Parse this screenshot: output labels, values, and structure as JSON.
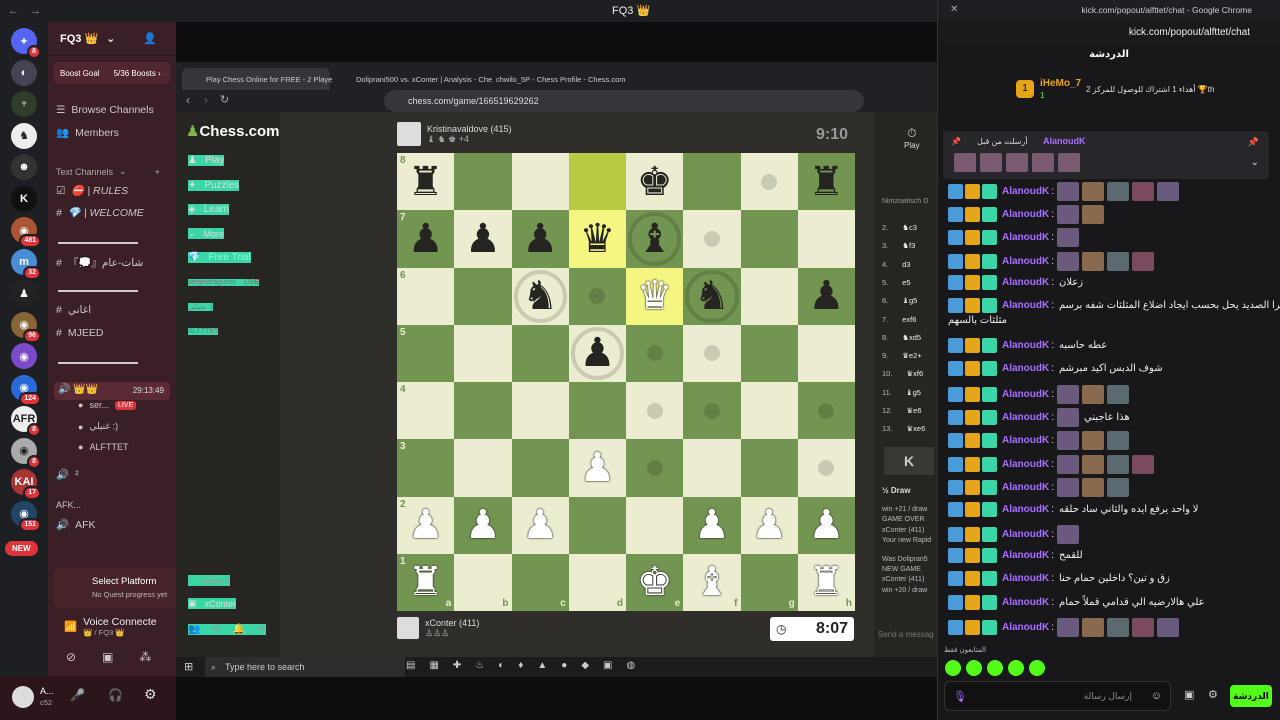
{
  "topbar": {
    "back": "←",
    "fwd": "→",
    "title": "FQ3 👑"
  },
  "rail": {
    "servers": [
      {
        "name": "discord",
        "badge": "8",
        "color": "#5865f2",
        "icon": "✦"
      },
      {
        "name": "s2",
        "badge": "",
        "color": "#445",
        "icon": "◐"
      },
      {
        "name": "s3",
        "badge": "",
        "color": "#2f3d2a",
        "icon": "♆"
      },
      {
        "name": "s4",
        "badge": "",
        "color": "#eee",
        "icon": "♞"
      },
      {
        "name": "s5",
        "badge": "",
        "color": "#333",
        "icon": "☻"
      },
      {
        "name": "kick",
        "badge": "",
        "color": "#111",
        "icon": "K"
      },
      {
        "name": "s7",
        "badge": "481",
        "color": "#a53",
        "icon": "◉"
      },
      {
        "name": "s8",
        "badge": "32",
        "color": "#4a8cd8",
        "icon": "m"
      },
      {
        "name": "s9",
        "badge": "",
        "color": "#222",
        "icon": "♟"
      },
      {
        "name": "s10",
        "badge": "96",
        "color": "#863",
        "icon": "◉"
      },
      {
        "name": "s11",
        "badge": "",
        "color": "#7a4ac8",
        "icon": "◉"
      },
      {
        "name": "s12",
        "badge": "124",
        "color": "#2a6ad8",
        "icon": "◉"
      },
      {
        "name": "s13",
        "badge": "8",
        "color": "#eee",
        "icon": "AFR"
      },
      {
        "name": "s14",
        "badge": "8",
        "color": "#aaa",
        "icon": "◉"
      },
      {
        "name": "s15",
        "badge": "17",
        "color": "#a33",
        "icon": "KAI"
      },
      {
        "name": "s16",
        "badge": "151",
        "color": "#246",
        "icon": "◉"
      }
    ],
    "new_label": "NEW"
  },
  "discord": {
    "server_name": "FQ3 👑",
    "boost_goal": "Boost Goal",
    "boost_count": "5/36 Boosts ›",
    "browse": "Browse Channels",
    "members": "Members",
    "text_channels": "Text Channels",
    "rules": "⛔ | RULES",
    "welcome": "💎 | WELCOME",
    "ch_ar1": "『💭』شات-عام",
    "ch_ar2": "اغاني",
    "ch_mjeed": "MJEED",
    "voice_time": "29:13:49",
    "voice_users": [
      {
        "name": "ser...",
        "live": "LIVE"
      },
      {
        "name": "غنيلي :)"
      },
      {
        "name": "ALFTTET"
      }
    ],
    "afk_cat": "AFK...",
    "afk": "AFK",
    "quest_title": "Select Platform",
    "quest_sub": "No Quest progress yet",
    "voice_conn": "Voice Connecte",
    "voice_sub": "👑 / FQ3 👑",
    "user": "A...",
    "user_sub": "c52"
  },
  "chrome": {
    "tabs": [
      "Play Chess Online for FREE - 2 Playe",
      "Doliprani500 vs. xConter | Analysis - Che",
      "chwilo_5P - Chess Profile - Chess.com"
    ],
    "url": "chess.com/game/166519629262"
  },
  "chess": {
    "logo": "Chess.com",
    "nav": [
      "Play",
      "Puzzles",
      "Learn",
      "More",
      "Free Trial"
    ],
    "friends": [
      "sergeidragunov",
      "عنبيلي :)",
      "ALFTTET"
    ],
    "live": "LIVE",
    "bottom_nav": [
      "Search",
      "xConter"
    ],
    "top_player": "Kristinavaldove (415)",
    "top_caps": "♝ ♞ ♚ +4",
    "top_clock": "9:10",
    "bottom_player": "xConter (411)",
    "bottom_caps": "♙♙♙",
    "bottom_clock": "8:07",
    "files": [
      "a",
      "b",
      "c",
      "d",
      "e",
      "f",
      "g",
      "h"
    ],
    "ranks": [
      "8",
      "7",
      "6",
      "5",
      "4",
      "3",
      "2",
      "1"
    ],
    "board": [
      [
        "bR",
        "",
        "",
        "",
        "bK",
        "",
        "",
        "bR"
      ],
      [
        "bP",
        "bP",
        "bP",
        "bQ",
        "bB",
        "",
        "",
        ""
      ],
      [
        "",
        "",
        "bN",
        "",
        "wQ",
        "bN",
        "",
        "bP"
      ],
      [
        "",
        "",
        "",
        "bP",
        "",
        "",
        "",
        ""
      ],
      [
        "",
        "",
        "",
        "",
        "",
        "",
        "",
        ""
      ],
      [
        "",
        "",
        "",
        "wP",
        "",
        "",
        "",
        ""
      ],
      [
        "wP",
        "wP",
        "wP",
        "",
        "",
        "wP",
        "wP",
        "wP"
      ],
      [
        "wR",
        "",
        "",
        "",
        "wK",
        "wB",
        "",
        "wR"
      ]
    ],
    "play_label": "Play",
    "opening": "Nimzowitsch D",
    "moves": [
      "2.",
      "3.",
      "4.",
      "5.",
      "6.",
      "7.",
      "8.",
      "9.",
      "10.",
      "11.",
      "12.",
      "13."
    ],
    "moves_w": [
      "♞c3",
      "♞f3",
      "d3",
      "e5",
      "♝g5",
      "exf6",
      "♞xd5",
      "♛e2+",
      "♛xf6",
      "♝g5",
      "♛e6",
      "♛xe6"
    ],
    "draw": "½ Draw",
    "log": [
      "win +21 / draw",
      "GAME OVER",
      "xConter (411)",
      "Your new Rapid",
      "Was Dolipran5",
      "NEW GAME",
      "xConter (411)",
      "win +20 / draw"
    ],
    "send": "Send a messag"
  },
  "taskbar": {
    "search": "Type here to search"
  },
  "kick": {
    "window_title": "kick.com/popout/alfttet/chat - Google Chrome",
    "url": "kick.com/popout/alfttet/chat",
    "title": "الدردشة",
    "gifter": "iHeMo_7",
    "gift_text": "أهداء 1 اشتراك للوصول للمركز 2 🏆th",
    "gift_count": "1",
    "pin_label": "أرسلت من قبل",
    "pin_user": "AlanoudK",
    "user": "AlanoudK",
    "messages": [
      {
        "text": "",
        "emotes": 5
      },
      {
        "text": "",
        "emotes": 2
      },
      {
        "text": "",
        "emotes": 1
      },
      {
        "text": "",
        "emotes": 4
      },
      {
        "text": "زعلان",
        "emotes": 0
      },
      {
        "text": "ترا الصديد يحل بحسب ايجاد اضلاع المثلثات شفه برسم",
        "emotes": 0,
        "wrap": "مثلثات بالسهم"
      },
      {
        "text": "عطه حاسبه",
        "emotes": 0
      },
      {
        "text": "شوف الدبس اكيد مبرشم",
        "emotes": 0
      },
      {
        "text": "",
        "emotes": 3
      },
      {
        "text": "هذا عاجبني",
        "emotes": 1
      },
      {
        "text": "",
        "emotes": 3
      },
      {
        "text": "",
        "emotes": 4
      },
      {
        "text": "",
        "emotes": 3
      },
      {
        "text": "لا واحد يرفع ايده والثاني ساد حلقه",
        "emotes": 0
      },
      {
        "text": "",
        "emotes": 1
      },
      {
        "text": "للقمح",
        "emotes": 0
      },
      {
        "text": "زق و تين؟ داخلين حمام حنا",
        "emotes": 0
      },
      {
        "text": "علي هالارضيه الي قدامي قملاً حمام",
        "emotes": 0
      },
      {
        "text": "",
        "emotes": 5
      }
    ],
    "users_label": "المتابعون فقط",
    "input_placeholder": "إرسال رسالة",
    "send": "الدردشة"
  }
}
